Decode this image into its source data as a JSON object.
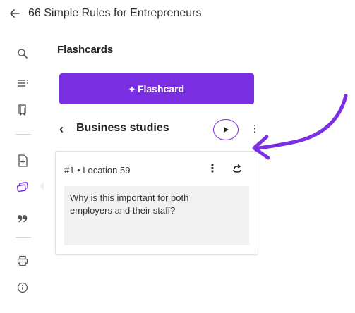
{
  "header": {
    "back_icon": "arrow-left-icon",
    "title": "66 Simple Rules for Entrepreneurs"
  },
  "rail": {
    "items": [
      {
        "icon": "search-icon"
      },
      {
        "icon": "table-of-contents-icon"
      },
      {
        "icon": "bookmark-icon"
      },
      {
        "icon": "add-note-icon"
      },
      {
        "icon": "flashcards-icon",
        "active": true
      },
      {
        "icon": "quotes-icon"
      },
      {
        "icon": "print-icon"
      },
      {
        "icon": "info-icon"
      }
    ]
  },
  "panel": {
    "title": "Flashcards",
    "add_button_label": "+ Flashcard",
    "deck": {
      "name": "Business studies"
    },
    "card": {
      "meta": "#1 • Location 59",
      "text": "Why is this important for both employers and their staff?"
    }
  },
  "colors": {
    "accent": "#7b2fe3",
    "card_body_bg": "#f1f1f1"
  }
}
